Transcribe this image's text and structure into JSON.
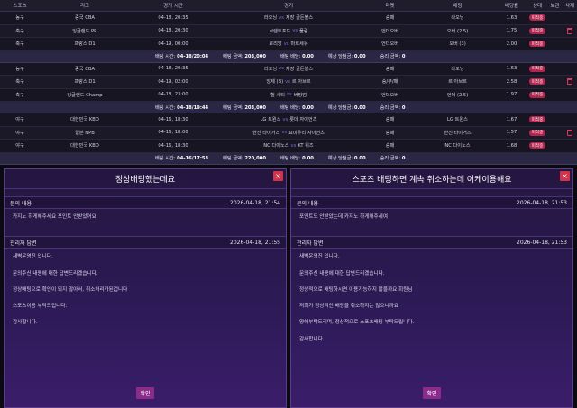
{
  "headers": [
    "스포츠",
    "리그",
    "경기 시간",
    "경기",
    "마켓",
    "배팅",
    "배당률",
    "상태",
    "보관",
    "삭제"
  ],
  "groups": [
    {
      "rows": [
        {
          "sport": "농구",
          "league": "중국 CBA",
          "time": "04-18, 20:35",
          "home": "라오닝",
          "away": "저장 골든불스",
          "market": "승패",
          "pick": "라오닝",
          "odds": "1.63",
          "status": "미적중",
          "trash": false
        },
        {
          "sport": "축구",
          "league": "잉글랜드 PR",
          "time": "04-18, 20:30",
          "home": "브렌트포드",
          "away": "풀럼",
          "market": "언더오버",
          "pick": "오버 (2.5)",
          "odds": "1.75",
          "status": "미적중",
          "trash": true
        },
        {
          "sport": "축구",
          "league": "프랑스 D1",
          "time": "04-19, 00:00",
          "home": "로리앙",
          "away": "마르세유",
          "market": "언더오버",
          "pick": "오버 (3)",
          "odds": "2.00",
          "status": "미적중",
          "trash": false
        }
      ],
      "summary": {
        "time_label": "배팅 시간:",
        "time": "04-18/20:04",
        "amount_label": "배팅 금액:",
        "amount": "203,000",
        "payout_label": "배팅 배당:",
        "payout": "0.00",
        "expected_label": "예상 당첨금:",
        "expected": "0.00",
        "win_label": "승리 금액:",
        "win": "0"
      }
    },
    {
      "rows": [
        {
          "sport": "농구",
          "league": "중국 CBA",
          "time": "04-18, 20:35",
          "home": "라오닝",
          "away": "저장 골든불스",
          "market": "승패",
          "pick": "라오닝",
          "odds": "1.63",
          "status": "미적중",
          "trash": false
        },
        {
          "sport": "축구",
          "league": "프랑스 D1",
          "time": "04-19, 02:00",
          "home": "앙제 (B)",
          "away": "르 아브르",
          "market": "승/무/패",
          "pick": "르 아브르",
          "odds": "2.58",
          "status": "미적중",
          "trash": true
        },
        {
          "sport": "축구",
          "league": "잉글랜드 Champ",
          "time": "04-18, 23:00",
          "home": "헐 시티",
          "away": "버밍엄",
          "market": "언더오버",
          "pick": "언더 (2.5)",
          "odds": "1.97",
          "status": "미적중",
          "trash": false
        }
      ],
      "summary": {
        "time_label": "배팅 시간:",
        "time": "04-18/19:44",
        "amount_label": "배팅 금액:",
        "amount": "203,000",
        "payout_label": "배팅 배당:",
        "payout": "0.00",
        "expected_label": "예상 당첨금:",
        "expected": "0.00",
        "win_label": "승리 금액:",
        "win": "0"
      }
    },
    {
      "rows": [
        {
          "sport": "야구",
          "league": "대한민국 KBO",
          "time": "04-16, 18:30",
          "home": "LG 트윈스",
          "away": "롯데 자이언츠",
          "market": "승패",
          "pick": "LG 트윈스",
          "odds": "1.67",
          "status": "미적중",
          "trash": false
        },
        {
          "sport": "야구",
          "league": "일본 NPB",
          "time": "04-16, 18:00",
          "home": "한신 타이거즈",
          "away": "요미우리 자이언츠",
          "market": "승패",
          "pick": "한신 타이거즈",
          "odds": "1.57",
          "status": "미적중",
          "trash": true
        },
        {
          "sport": "야구",
          "league": "대한민국 KBO",
          "time": "04-16, 18:30",
          "home": "NC 다이노스",
          "away": "KT 위즈",
          "market": "승패",
          "pick": "NC 다이노스",
          "odds": "1.68",
          "status": "미적중",
          "trash": false
        }
      ],
      "summary": {
        "time_label": "배팅 시간:",
        "time": "04-16/17:53",
        "amount_label": "배팅 금액:",
        "amount": "220,000",
        "payout_label": "배팅 배당:",
        "payout": "0.00",
        "expected_label": "예상 당첨금:",
        "expected": "0.00",
        "win_label": "승리 금액:",
        "win": "0"
      }
    }
  ],
  "vs": "vs",
  "dialog_left": {
    "title": "정상배팅했는데요",
    "close": "×",
    "question_label": "문의 내용",
    "question_date": "2026-04-18, 21:54",
    "question_text": "카지노 하게해주세요 포인트 안받았어요",
    "answer_label": "관리자 답변",
    "answer_date": "2026-04-18, 21:55",
    "answer_lines": [
      "새벽운영진 입니다.",
      "문의주신 내용에 대한 답변드리겠습니다.",
      "정상배팅으로 확인이 되지 않아서, 취소처리가된겁니다",
      "스포츠이용 부탁드립니다.",
      "감사합니다."
    ],
    "ok": "확인"
  },
  "dialog_right": {
    "title": "스포츠 배팅하면 계속 취소하는데 어케이용해요",
    "close": "×",
    "question_label": "문의 내용",
    "question_date": "2026-04-18, 21:53",
    "question_text": "포인트도 안받았는데 카지노 하게해주세여",
    "answer_label": "관리자 답변",
    "answer_date": "2026-04-18, 21:53",
    "answer_lines": [
      "새벽운영진 입니다.",
      "문의주신 내용에 대한 답변드리겠습니다.",
      "정상적으로 배팅하시면 이용가능하지 않을까요 회원님",
      "저희가 정상적인 배팅을 취소하지는 않으니까요",
      "양해부탁드리며, 정상적으로 스포츠배팅 부탁드립니다.",
      "감사합니다."
    ],
    "ok": "확인"
  }
}
